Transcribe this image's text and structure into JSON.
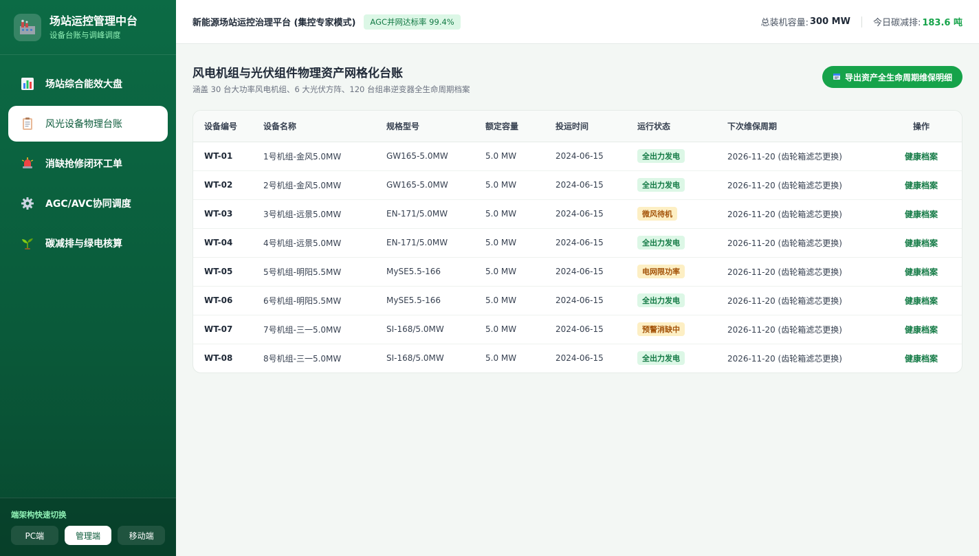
{
  "brand": {
    "title": "场站运控管理中台",
    "subtitle": "设备台账与调峰调度",
    "logo_icon": "factory-icon"
  },
  "nav": [
    {
      "label": "场站综合能效大盘",
      "icon": "bar-chart-icon",
      "active": false
    },
    {
      "label": "风光设备物理台账",
      "icon": "clipboard-icon",
      "active": true
    },
    {
      "label": "消缺抢修闭环工单",
      "icon": "siren-icon",
      "active": false
    },
    {
      "label": "AGC/AVC协同调度",
      "icon": "gear-icon",
      "active": false
    },
    {
      "label": "碳减排与绿电核算",
      "icon": "seedling-icon",
      "active": false
    }
  ],
  "switcher": {
    "title": "端架构快速切换",
    "options": [
      "PC端",
      "管理端",
      "移动端"
    ],
    "active": "管理端"
  },
  "header": {
    "title": "新能源场站运控治理平台 (集控专家模式)",
    "agc_badge": "AGC并网达标率 99.4%",
    "capacity_label": "总装机容量:",
    "capacity_value": "300 MW",
    "carbon_label": "今日碳减排:",
    "carbon_value": "183.6 吨"
  },
  "page": {
    "title": "风电机组与光伏组件物理资产网格化台账",
    "subtitle": "涵盖 30 台大功率风电机组、6 大光伏方阵、120 台组串逆变器全生命周期档案",
    "export_label": "导出资产全生命周期维保明细",
    "export_icon": "export-icon"
  },
  "table": {
    "columns": [
      "设备编号",
      "设备名称",
      "规格型号",
      "额定容量",
      "投运时间",
      "运行状态",
      "下次维保周期",
      "操作"
    ],
    "rows": [
      {
        "id": "WT-01",
        "name": "1号机组-金风5.0MW",
        "model": "GW165-5.0MW",
        "capacity": "5.0 MW",
        "date": "2024-06-15",
        "status": "全出力发电",
        "status_type": "ok",
        "maintenance": "2026-11-20 (齿轮箱滤芯更换)",
        "action": "健康档案"
      },
      {
        "id": "WT-02",
        "name": "2号机组-金风5.0MW",
        "model": "GW165-5.0MW",
        "capacity": "5.0 MW",
        "date": "2024-06-15",
        "status": "全出力发电",
        "status_type": "ok",
        "maintenance": "2026-11-20 (齿轮箱滤芯更换)",
        "action": "健康档案"
      },
      {
        "id": "WT-03",
        "name": "3号机组-远景5.0MW",
        "model": "EN-171/5.0MW",
        "capacity": "5.0 MW",
        "date": "2024-06-15",
        "status": "微风待机",
        "status_type": "warn",
        "maintenance": "2026-11-20 (齿轮箱滤芯更换)",
        "action": "健康档案"
      },
      {
        "id": "WT-04",
        "name": "4号机组-远景5.0MW",
        "model": "EN-171/5.0MW",
        "capacity": "5.0 MW",
        "date": "2024-06-15",
        "status": "全出力发电",
        "status_type": "ok",
        "maintenance": "2026-11-20 (齿轮箱滤芯更换)",
        "action": "健康档案"
      },
      {
        "id": "WT-05",
        "name": "5号机组-明阳5.5MW",
        "model": "MySE5.5-166",
        "capacity": "5.0 MW",
        "date": "2024-06-15",
        "status": "电网限功率",
        "status_type": "warn",
        "maintenance": "2026-11-20 (齿轮箱滤芯更换)",
        "action": "健康档案"
      },
      {
        "id": "WT-06",
        "name": "6号机组-明阳5.5MW",
        "model": "MySE5.5-166",
        "capacity": "5.0 MW",
        "date": "2024-06-15",
        "status": "全出力发电",
        "status_type": "ok",
        "maintenance": "2026-11-20 (齿轮箱滤芯更换)",
        "action": "健康档案"
      },
      {
        "id": "WT-07",
        "name": "7号机组-三一5.0MW",
        "model": "SI-168/5.0MW",
        "capacity": "5.0 MW",
        "date": "2024-06-15",
        "status": "预警消缺中",
        "status_type": "warn",
        "maintenance": "2026-11-20 (齿轮箱滤芯更换)",
        "action": "健康档案"
      },
      {
        "id": "WT-08",
        "name": "8号机组-三一5.0MW",
        "model": "SI-168/5.0MW",
        "capacity": "5.0 MW",
        "date": "2024-06-15",
        "status": "全出力发电",
        "status_type": "ok",
        "maintenance": "2026-11-20 (齿轮箱滤芯更换)",
        "action": "健康档案"
      }
    ]
  },
  "colors": {
    "sidebar": "#0c6b45",
    "accent": "#16a34a",
    "ok_bg": "#dcf7e6",
    "warn_bg": "#fdefc4"
  }
}
